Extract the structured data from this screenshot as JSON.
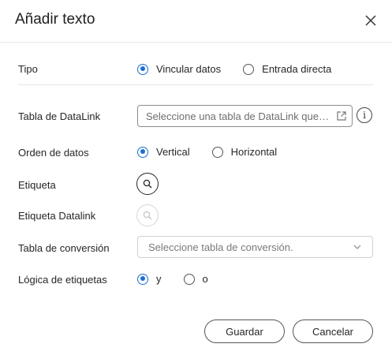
{
  "dialog": {
    "title": "Añadir texto",
    "close_icon": "close-icon"
  },
  "fields": {
    "tipo": {
      "label": "Tipo",
      "options": [
        "Vincular datos",
        "Entrada directa"
      ],
      "selected": "Vincular datos"
    },
    "tabla_datalink": {
      "label": "Tabla de DataLink",
      "placeholder": "Seleccione una tabla de DataLink que vincu...",
      "trailing_icon": "external-link-icon",
      "info_icon": "info-icon",
      "info_glyph": "i"
    },
    "orden_datos": {
      "label": "Orden de datos",
      "options": [
        "Vertical",
        "Horizontal"
      ],
      "selected": "Vertical"
    },
    "etiqueta": {
      "label": "Etiqueta",
      "button_icon": "search-icon",
      "enabled": true
    },
    "etiqueta_datalink": {
      "label": "Etiqueta Datalink",
      "button_icon": "search-icon",
      "enabled": false
    },
    "tabla_conversion": {
      "label": "Tabla de conversión",
      "placeholder": "Seleccione tabla de conversión.",
      "trailing_icon": "chevron-down-icon"
    },
    "logica_etiquetas": {
      "label": "Lógica de etiquetas",
      "options": [
        "y",
        "o"
      ],
      "selected": "y"
    }
  },
  "footer": {
    "save_label": "Guardar",
    "cancel_label": "Cancelar"
  },
  "colors": {
    "accent": "#1a6fd1",
    "divider": "#e6e6e6",
    "text": "#262626",
    "placeholder": "#6e6e6e"
  }
}
